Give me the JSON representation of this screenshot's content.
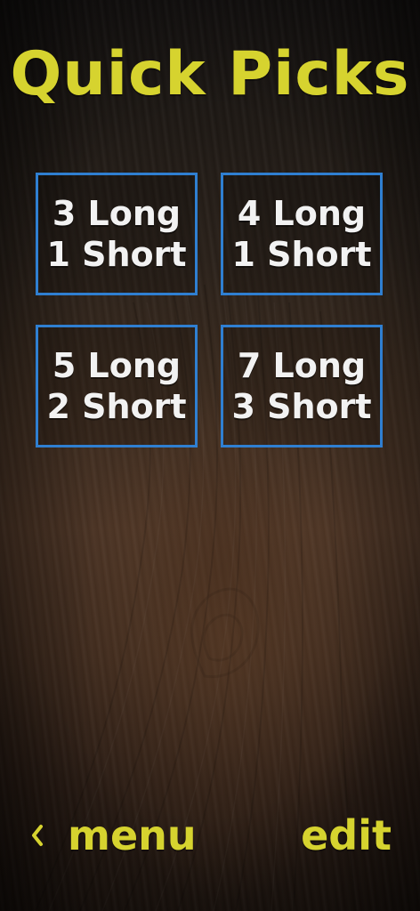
{
  "header": {
    "title": "Quick Picks"
  },
  "picks": [
    {
      "line1": "3 Long",
      "line2": "1 Short"
    },
    {
      "line1": "4 Long",
      "line2": "1 Short"
    },
    {
      "line1": "5 Long",
      "line2": "2 Short"
    },
    {
      "line1": "7 Long",
      "line2": "3 Short"
    }
  ],
  "footer": {
    "back_label": "menu",
    "back_icon": "chevron-left-icon",
    "edit_label": "edit"
  },
  "colors": {
    "title": "#d6d32f",
    "tile_border": "#2f7fd1",
    "tile_text": "#f2f2f2"
  }
}
